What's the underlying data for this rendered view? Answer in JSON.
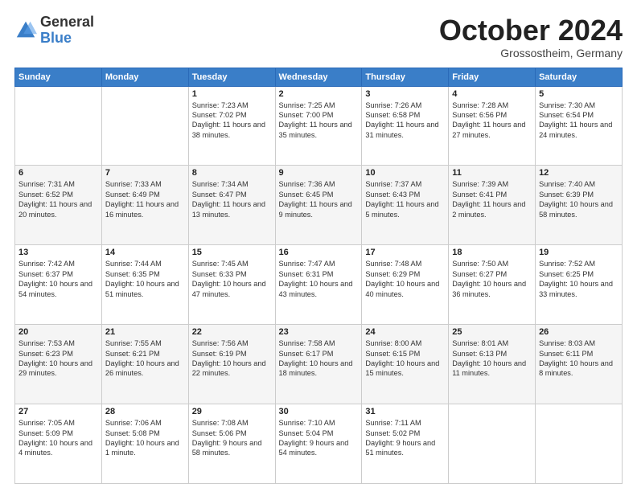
{
  "logo": {
    "general": "General",
    "blue": "Blue"
  },
  "title": "October 2024",
  "subtitle": "Grossostheim, Germany",
  "days_of_week": [
    "Sunday",
    "Monday",
    "Tuesday",
    "Wednesday",
    "Thursday",
    "Friday",
    "Saturday"
  ],
  "weeks": [
    [
      {
        "day": "",
        "info": ""
      },
      {
        "day": "",
        "info": ""
      },
      {
        "day": "1",
        "info": "Sunrise: 7:23 AM\nSunset: 7:02 PM\nDaylight: 11 hours and 38 minutes."
      },
      {
        "day": "2",
        "info": "Sunrise: 7:25 AM\nSunset: 7:00 PM\nDaylight: 11 hours and 35 minutes."
      },
      {
        "day": "3",
        "info": "Sunrise: 7:26 AM\nSunset: 6:58 PM\nDaylight: 11 hours and 31 minutes."
      },
      {
        "day": "4",
        "info": "Sunrise: 7:28 AM\nSunset: 6:56 PM\nDaylight: 11 hours and 27 minutes."
      },
      {
        "day": "5",
        "info": "Sunrise: 7:30 AM\nSunset: 6:54 PM\nDaylight: 11 hours and 24 minutes."
      }
    ],
    [
      {
        "day": "6",
        "info": "Sunrise: 7:31 AM\nSunset: 6:52 PM\nDaylight: 11 hours and 20 minutes."
      },
      {
        "day": "7",
        "info": "Sunrise: 7:33 AM\nSunset: 6:49 PM\nDaylight: 11 hours and 16 minutes."
      },
      {
        "day": "8",
        "info": "Sunrise: 7:34 AM\nSunset: 6:47 PM\nDaylight: 11 hours and 13 minutes."
      },
      {
        "day": "9",
        "info": "Sunrise: 7:36 AM\nSunset: 6:45 PM\nDaylight: 11 hours and 9 minutes."
      },
      {
        "day": "10",
        "info": "Sunrise: 7:37 AM\nSunset: 6:43 PM\nDaylight: 11 hours and 5 minutes."
      },
      {
        "day": "11",
        "info": "Sunrise: 7:39 AM\nSunset: 6:41 PM\nDaylight: 11 hours and 2 minutes."
      },
      {
        "day": "12",
        "info": "Sunrise: 7:40 AM\nSunset: 6:39 PM\nDaylight: 10 hours and 58 minutes."
      }
    ],
    [
      {
        "day": "13",
        "info": "Sunrise: 7:42 AM\nSunset: 6:37 PM\nDaylight: 10 hours and 54 minutes."
      },
      {
        "day": "14",
        "info": "Sunrise: 7:44 AM\nSunset: 6:35 PM\nDaylight: 10 hours and 51 minutes."
      },
      {
        "day": "15",
        "info": "Sunrise: 7:45 AM\nSunset: 6:33 PM\nDaylight: 10 hours and 47 minutes."
      },
      {
        "day": "16",
        "info": "Sunrise: 7:47 AM\nSunset: 6:31 PM\nDaylight: 10 hours and 43 minutes."
      },
      {
        "day": "17",
        "info": "Sunrise: 7:48 AM\nSunset: 6:29 PM\nDaylight: 10 hours and 40 minutes."
      },
      {
        "day": "18",
        "info": "Sunrise: 7:50 AM\nSunset: 6:27 PM\nDaylight: 10 hours and 36 minutes."
      },
      {
        "day": "19",
        "info": "Sunrise: 7:52 AM\nSunset: 6:25 PM\nDaylight: 10 hours and 33 minutes."
      }
    ],
    [
      {
        "day": "20",
        "info": "Sunrise: 7:53 AM\nSunset: 6:23 PM\nDaylight: 10 hours and 29 minutes."
      },
      {
        "day": "21",
        "info": "Sunrise: 7:55 AM\nSunset: 6:21 PM\nDaylight: 10 hours and 26 minutes."
      },
      {
        "day": "22",
        "info": "Sunrise: 7:56 AM\nSunset: 6:19 PM\nDaylight: 10 hours and 22 minutes."
      },
      {
        "day": "23",
        "info": "Sunrise: 7:58 AM\nSunset: 6:17 PM\nDaylight: 10 hours and 18 minutes."
      },
      {
        "day": "24",
        "info": "Sunrise: 8:00 AM\nSunset: 6:15 PM\nDaylight: 10 hours and 15 minutes."
      },
      {
        "day": "25",
        "info": "Sunrise: 8:01 AM\nSunset: 6:13 PM\nDaylight: 10 hours and 11 minutes."
      },
      {
        "day": "26",
        "info": "Sunrise: 8:03 AM\nSunset: 6:11 PM\nDaylight: 10 hours and 8 minutes."
      }
    ],
    [
      {
        "day": "27",
        "info": "Sunrise: 7:05 AM\nSunset: 5:09 PM\nDaylight: 10 hours and 4 minutes."
      },
      {
        "day": "28",
        "info": "Sunrise: 7:06 AM\nSunset: 5:08 PM\nDaylight: 10 hours and 1 minute."
      },
      {
        "day": "29",
        "info": "Sunrise: 7:08 AM\nSunset: 5:06 PM\nDaylight: 9 hours and 58 minutes."
      },
      {
        "day": "30",
        "info": "Sunrise: 7:10 AM\nSunset: 5:04 PM\nDaylight: 9 hours and 54 minutes."
      },
      {
        "day": "31",
        "info": "Sunrise: 7:11 AM\nSunset: 5:02 PM\nDaylight: 9 hours and 51 minutes."
      },
      {
        "day": "",
        "info": ""
      },
      {
        "day": "",
        "info": ""
      }
    ]
  ]
}
